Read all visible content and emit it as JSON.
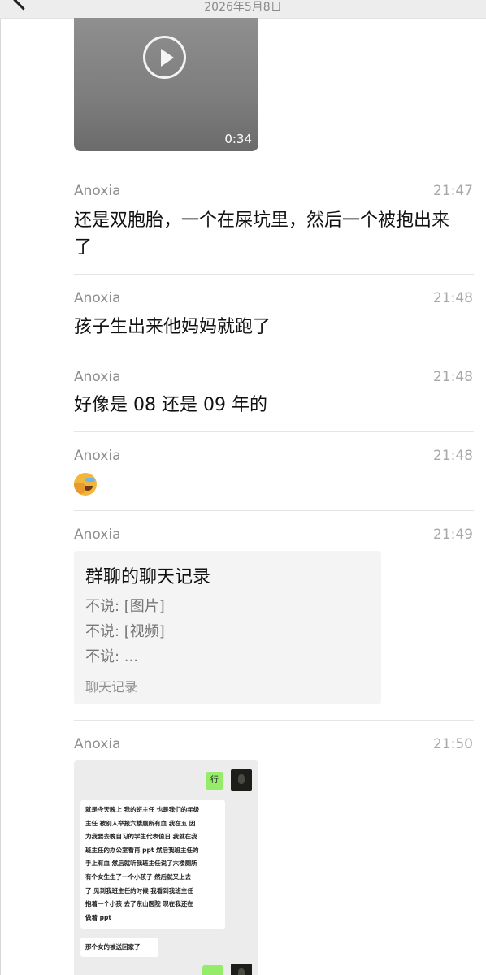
{
  "header": {
    "date": "2026年5月8日"
  },
  "video": {
    "duration": "0:34"
  },
  "messages": [
    {
      "sender": "Anoxia",
      "time": "21:47",
      "text": "还是双胞胎，一个在屎坑里，然后一个被抱出来了"
    },
    {
      "sender": "Anoxia",
      "time": "21:48",
      "text": "孩子生出来他妈妈就跑了"
    },
    {
      "sender": "Anoxia",
      "time": "21:48",
      "text": "好像是 08 还是 09 年的"
    },
    {
      "sender": "Anoxia",
      "time": "21:48",
      "emoji": "crying-laughing-emoji"
    },
    {
      "sender": "Anoxia",
      "time": "21:49"
    },
    {
      "sender": "Anoxia",
      "time": "21:50"
    }
  ],
  "chat_record": {
    "title": "群聊的聊天记录",
    "lines": [
      "不说: [图片]",
      "不说: [视频]",
      "不说: ..."
    ],
    "footer": "聊天记录"
  },
  "screenshot": {
    "reply_1": "行",
    "message_lines": [
      "就是今天晚上 我的班主任 也是我们的年级",
      "主任 被别人举报六楼厕所有血 我在五 因",
      "为我要去晚自习的学生代表值日 我就在我",
      "班主任的办公室看再 ppt 然后我班主任的",
      "手上有血 然后就听我班主任说了六楼厕所",
      "有个女生生了一个小孩子 然后就又上去",
      "了 见到我班主任的时候 我看到我班主任",
      "抱着一个小孩 去了东山医院 现在我还在",
      "做着 ppt"
    ],
    "message_2": "那个女的被送回家了"
  }
}
